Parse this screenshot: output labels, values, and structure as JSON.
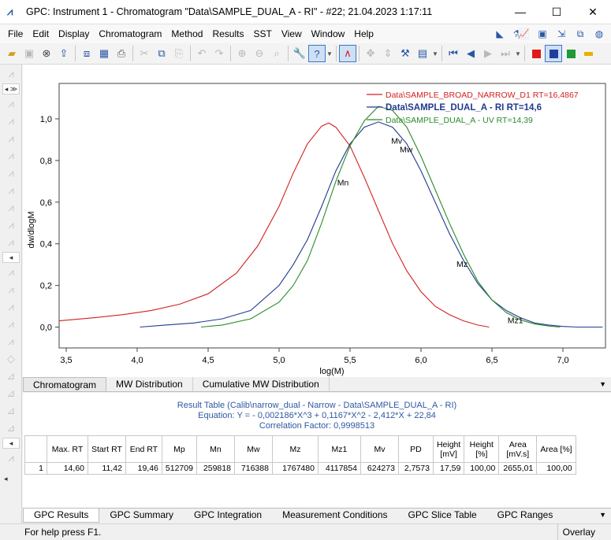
{
  "window": {
    "title": "GPC: Instrument 1 - Chromatogram \"Data\\SAMPLE_DUAL_A - RI\" - #22;   21.04.2023   1:17:11",
    "minimize": "—",
    "maximize": "☐",
    "close": "✕"
  },
  "menu": [
    "File",
    "Edit",
    "Display",
    "Chromatogram",
    "Method",
    "Results",
    "SST",
    "View",
    "Window",
    "Help"
  ],
  "chart_data": {
    "type": "line",
    "xlabel": "log(M)",
    "ylabel": "dw/dlogM",
    "xlim": [
      3.45,
      7.3
    ],
    "ylim": [
      -0.1,
      1.17
    ],
    "xticks": [
      "3,5",
      "4,0",
      "4,5",
      "5,0",
      "5,5",
      "6,0",
      "6,5",
      "7,0"
    ],
    "xtick_values": [
      3.5,
      4.0,
      4.5,
      5.0,
      5.5,
      6.0,
      6.5,
      7.0
    ],
    "yticks": [
      "0,0",
      "0,2",
      "0,4",
      "0,6",
      "0,8",
      "1,0"
    ],
    "ytick_values": [
      0,
      0.2,
      0.4,
      0.6,
      0.8,
      1.0
    ],
    "legend_position": "top-right",
    "series": [
      {
        "name": "Data\\SAMPLE_BROAD_NARROW_D1 RT=16,4867",
        "color": "#d42020",
        "x": [
          3.45,
          3.7,
          3.9,
          4.1,
          4.3,
          4.5,
          4.7,
          4.85,
          5.0,
          5.1,
          5.2,
          5.3,
          5.35,
          5.4,
          5.5,
          5.6,
          5.7,
          5.8,
          5.9,
          6.0,
          6.1,
          6.2,
          6.3,
          6.4,
          6.48
        ],
        "y": [
          0.03,
          0.045,
          0.06,
          0.08,
          0.11,
          0.16,
          0.26,
          0.39,
          0.58,
          0.74,
          0.88,
          0.965,
          0.98,
          0.96,
          0.87,
          0.72,
          0.56,
          0.4,
          0.27,
          0.17,
          0.1,
          0.06,
          0.03,
          0.01,
          0.0
        ]
      },
      {
        "name": "Data\\SAMPLE_DUAL_A - RI RT=14,6",
        "color": "#203a8e",
        "bold": true,
        "x": [
          4.02,
          4.2,
          4.4,
          4.6,
          4.8,
          5.0,
          5.1,
          5.2,
          5.3,
          5.4,
          5.5,
          5.6,
          5.7,
          5.8,
          5.9,
          6.0,
          6.1,
          6.2,
          6.3,
          6.4,
          6.5,
          6.6,
          6.7,
          6.8,
          6.9,
          7.0,
          7.1,
          7.28
        ],
        "y": [
          0.0,
          0.01,
          0.02,
          0.04,
          0.08,
          0.2,
          0.3,
          0.42,
          0.58,
          0.75,
          0.88,
          0.96,
          0.985,
          0.96,
          0.88,
          0.75,
          0.6,
          0.45,
          0.32,
          0.21,
          0.13,
          0.08,
          0.045,
          0.02,
          0.01,
          0.003,
          0.0,
          0.0
        ]
      },
      {
        "name": "Data\\SAMPLE_DUAL_A - UV RT=14,39",
        "color": "#2a8a2a",
        "x": [
          4.45,
          4.6,
          4.8,
          5.0,
          5.1,
          5.2,
          5.3,
          5.4,
          5.5,
          5.6,
          5.7,
          5.8,
          5.9,
          6.0,
          6.1,
          6.2,
          6.3,
          6.4,
          6.5,
          6.6,
          6.7,
          6.8,
          6.9,
          6.98
        ],
        "y": [
          0.0,
          0.01,
          0.04,
          0.12,
          0.2,
          0.32,
          0.5,
          0.7,
          0.87,
          0.99,
          1.06,
          1.04,
          0.96,
          0.82,
          0.66,
          0.5,
          0.35,
          0.22,
          0.13,
          0.07,
          0.035,
          0.015,
          0.005,
          0.0
        ]
      }
    ],
    "annotations": [
      {
        "text": "Mn",
        "x": 5.41,
        "y": 0.68
      },
      {
        "text": "Mv",
        "x": 5.79,
        "y": 0.88
      },
      {
        "text": "Mw",
        "x": 5.85,
        "y": 0.84
      },
      {
        "text": "Mz",
        "x": 6.25,
        "y": 0.29
      },
      {
        "text": "Mz1",
        "x": 6.61,
        "y": 0.02
      }
    ]
  },
  "tabs_top": [
    "Chromatogram",
    "MW Distribution",
    "Cumulative MW Distribution"
  ],
  "result": {
    "line1": "Result Table (Calib\\narrow_dual - Narrow - Data\\SAMPLE_DUAL_A - RI)",
    "line2": "Equation: Y =  - 0,002186*X^3 + 0,1167*X^2 - 2,412*X + 22,84",
    "line3": "Correlation Factor: 0,9998513",
    "headers": [
      "",
      "Max. RT",
      "Start RT",
      "End RT",
      "Mp",
      "Mn",
      "Mw",
      "Mz",
      "Mz1",
      "Mv",
      "PD",
      "Height\n[mV]",
      "Height\n[%]",
      "Area\n[mV.s]",
      "Area [%]"
    ],
    "row": [
      "1",
      "14,60",
      "11,42",
      "19,46",
      "512709",
      "259818",
      "716388",
      "1767480",
      "4117854",
      "624273",
      "2,7573",
      "17,59",
      "100,00",
      "2655,01",
      "100,00"
    ]
  },
  "tabs_bottom": [
    "GPC Results",
    "GPC Summary",
    "GPC Integration",
    "Measurement Conditions",
    "GPC Slice Table",
    "GPC Ranges"
  ],
  "status": {
    "left": "For help press F1.",
    "right": "Overlay"
  }
}
